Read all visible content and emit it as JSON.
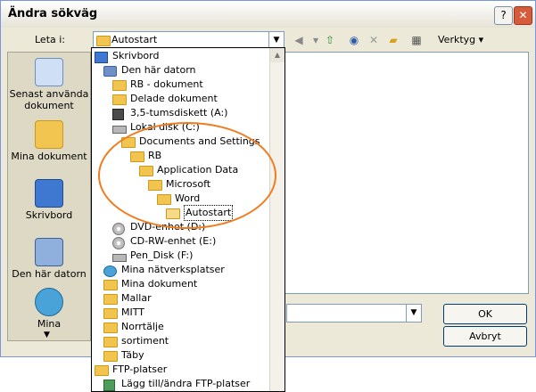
{
  "window": {
    "title": "Ändra sökväg",
    "help_label": "?",
    "close_label": "✕"
  },
  "toolbar": {
    "look_in_label": "Leta i:",
    "look_in_value": "Autostart",
    "tools_label": "Verktyg ▾"
  },
  "places": [
    {
      "label": "Senast använda dokument",
      "icon": "recent-docs-icon"
    },
    {
      "label": "Mina dokument",
      "icon": "my-documents-icon"
    },
    {
      "label": "Skrivbord",
      "icon": "desktop-icon"
    },
    {
      "label": "Den här datorn",
      "icon": "my-computer-icon"
    },
    {
      "label": "Mina",
      "icon": "network-places-icon"
    }
  ],
  "dropdown_items": [
    {
      "label": "Skrivbord",
      "icon": "desktop-icon"
    },
    {
      "label": "Den här datorn",
      "icon": "computer-icon"
    },
    {
      "label": "RB - dokument",
      "icon": "folder-icon"
    },
    {
      "label": "Delade dokument",
      "icon": "folder-icon"
    },
    {
      "label": "3,5-tumsdiskett (A:)",
      "icon": "floppy-icon"
    },
    {
      "label": "Lokal disk (C:)",
      "icon": "drive-icon"
    },
    {
      "label": "Documents and Settings",
      "icon": "folder-icon"
    },
    {
      "label": "RB",
      "icon": "folder-icon"
    },
    {
      "label": "Application Data",
      "icon": "folder-icon"
    },
    {
      "label": "Microsoft",
      "icon": "folder-icon"
    },
    {
      "label": "Word",
      "icon": "folder-icon"
    },
    {
      "label": "Autostart",
      "icon": "open-folder-icon"
    },
    {
      "label": "DVD-enhet (D:)",
      "icon": "cd-icon"
    },
    {
      "label": "CD-RW-enhet (E:)",
      "icon": "cd-icon"
    },
    {
      "label": "Pen_Disk (F:)",
      "icon": "drive-icon"
    },
    {
      "label": "Mina nätverksplatser",
      "icon": "network-icon"
    },
    {
      "label": "Mina dokument",
      "icon": "folder-icon"
    },
    {
      "label": "Mallar",
      "icon": "folder-icon"
    },
    {
      "label": "MITT",
      "icon": "folder-icon"
    },
    {
      "label": "Norrtälje",
      "icon": "folder-icon"
    },
    {
      "label": "sortiment",
      "icon": "folder-icon"
    },
    {
      "label": "Täby",
      "icon": "folder-icon"
    },
    {
      "label": "FTP-platser",
      "icon": "folder-icon"
    },
    {
      "label": "Lägg till/ändra FTP-platser",
      "icon": "ftp-icon"
    }
  ],
  "buttons": {
    "ok": "OK",
    "cancel": "Avbryt"
  },
  "colors": {
    "highlight_ellipse": "#f07c1e",
    "title_bar": "#ffffff",
    "dialog_bg": "#ece9d8"
  }
}
